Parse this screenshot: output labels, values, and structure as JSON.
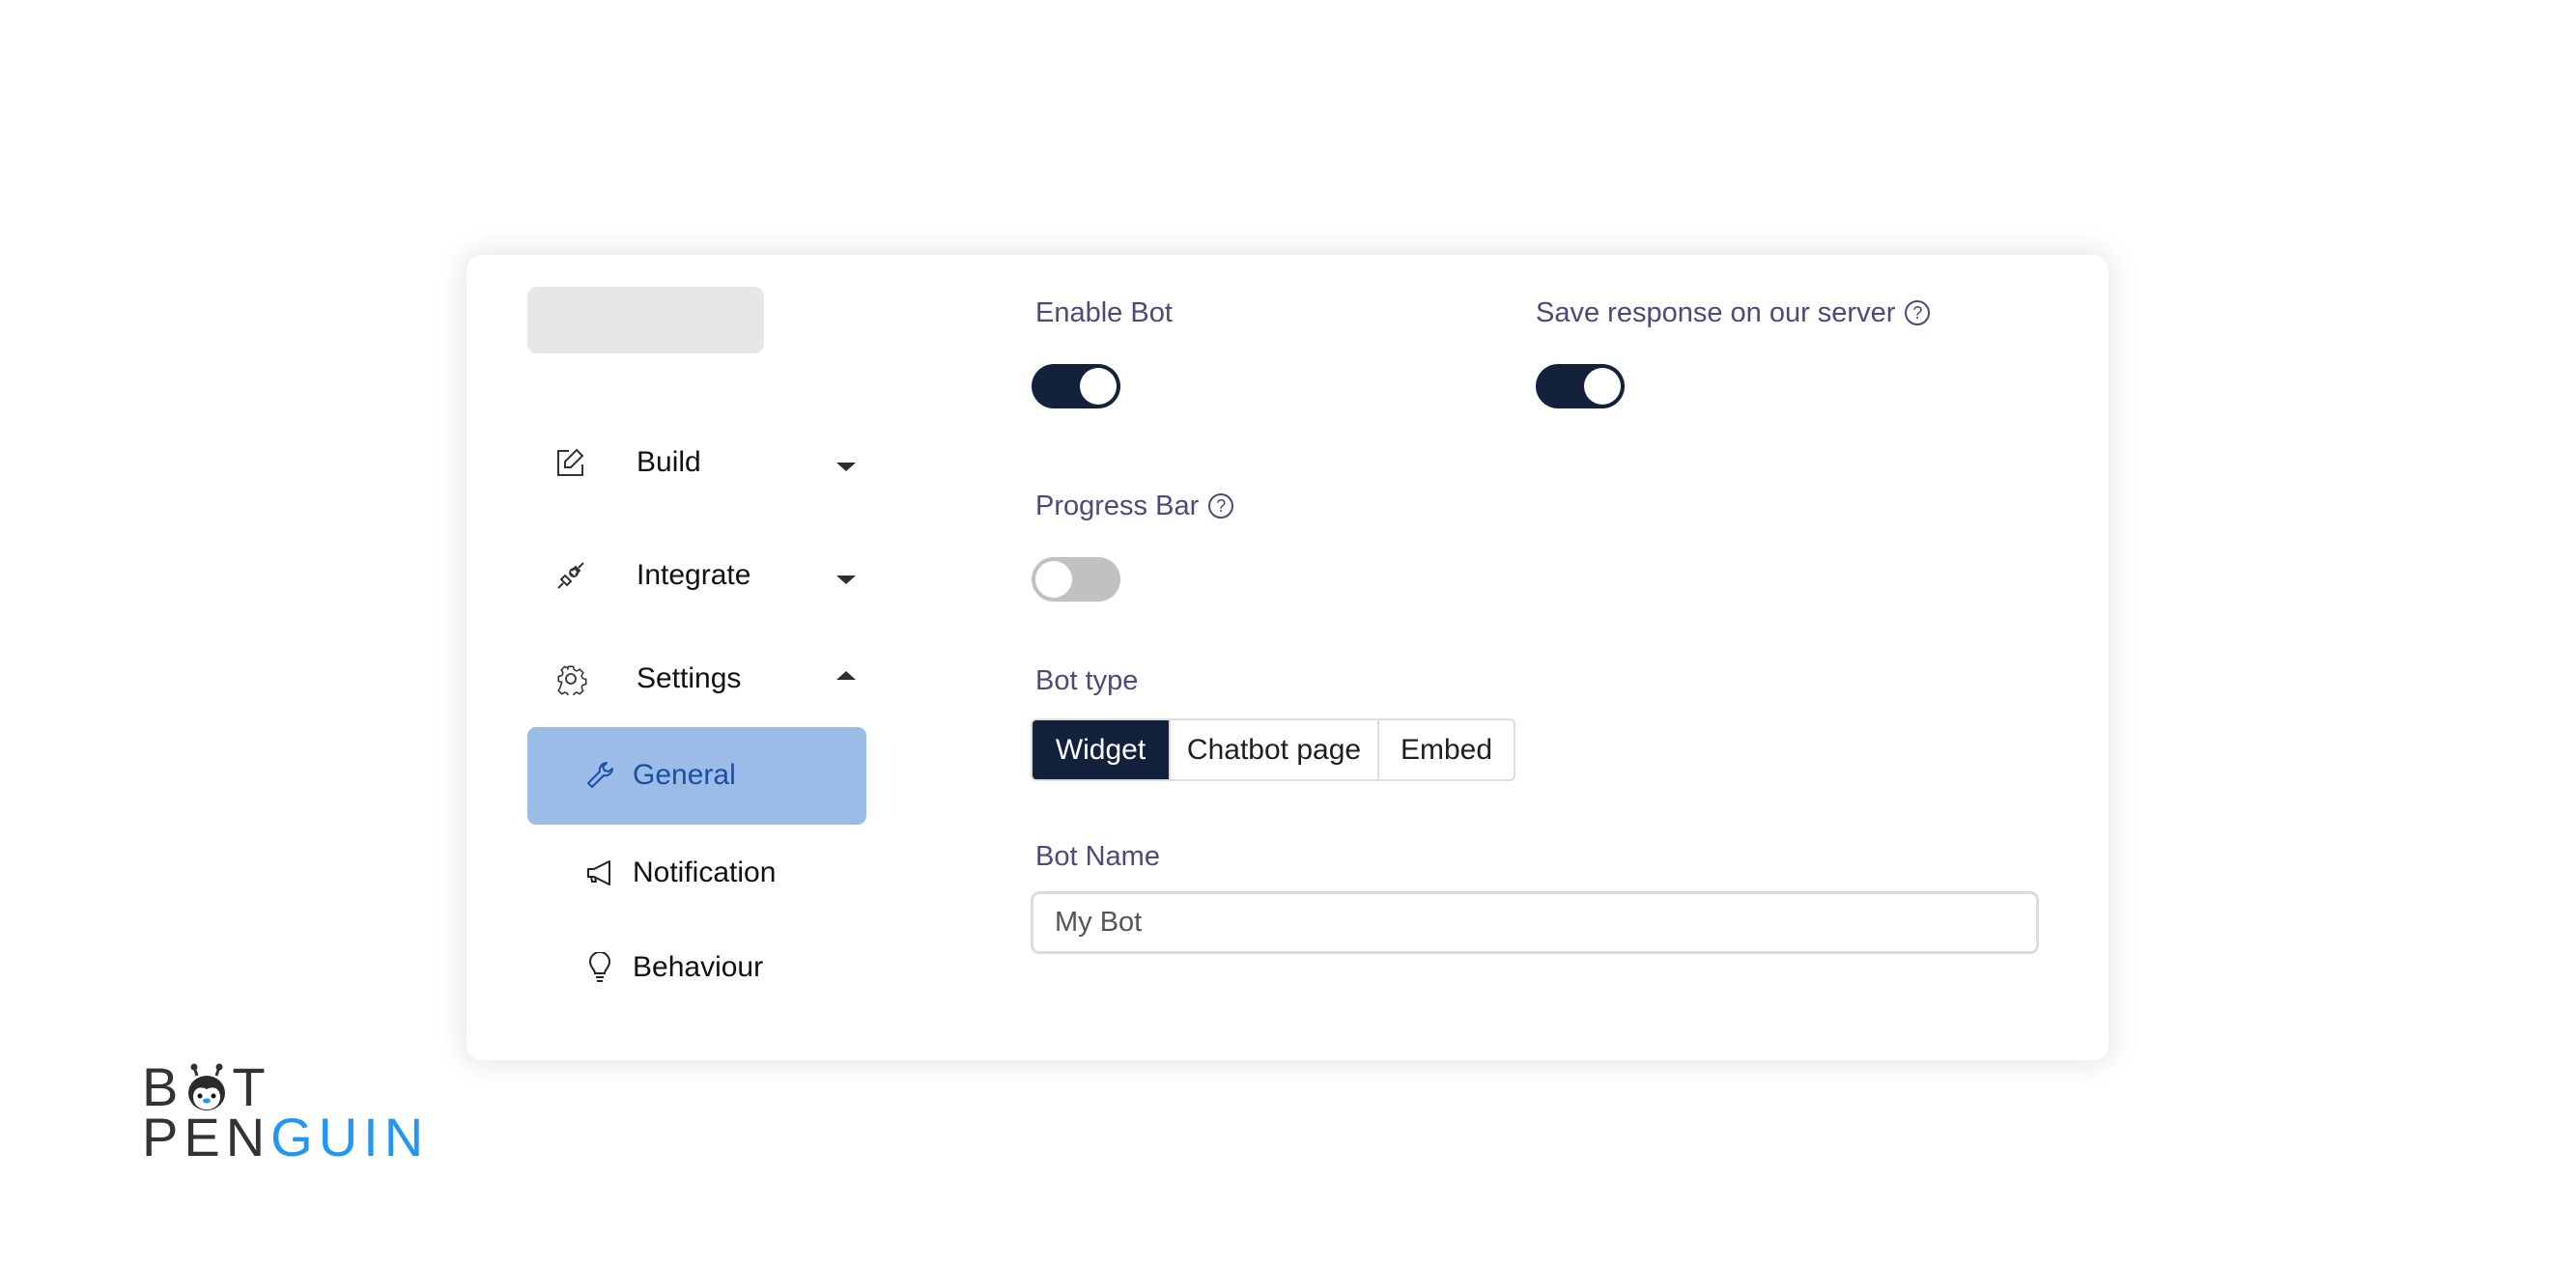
{
  "sidebar": {
    "items": [
      {
        "label": "Build",
        "icon": "edit-icon",
        "expanded": false
      },
      {
        "label": "Integrate",
        "icon": "plug-icon",
        "expanded": false
      },
      {
        "label": "Settings",
        "icon": "gear-icon",
        "expanded": true
      }
    ],
    "sub_items": [
      {
        "label": "General",
        "icon": "wrench-icon",
        "active": true
      },
      {
        "label": "Notification",
        "icon": "megaphone-icon",
        "active": false
      },
      {
        "label": "Behaviour",
        "icon": "lightbulb-icon",
        "active": false
      }
    ]
  },
  "settings": {
    "enable_bot": {
      "label": "Enable Bot",
      "value": true
    },
    "save_response": {
      "label": "Save response on our server",
      "value": true,
      "help": "?"
    },
    "progress_bar": {
      "label": "Progress Bar",
      "value": false,
      "help": "?"
    },
    "bot_type": {
      "label": "Bot type",
      "options": [
        "Widget",
        "Chatbot page",
        "Embed"
      ],
      "selected": "Widget"
    },
    "bot_name": {
      "label": "Bot Name",
      "value": "My Bot"
    }
  },
  "brand": {
    "line1_left": "B",
    "line1_right": "T",
    "line2_dark": "PEN",
    "line2_accent": "GUIN",
    "accent_color": "#2196f3"
  },
  "colors": {
    "primary": "#14213d",
    "active_nav_bg": "#9cbce8",
    "active_nav_text": "#1b4fa3",
    "label_text": "#4b4a7a"
  }
}
